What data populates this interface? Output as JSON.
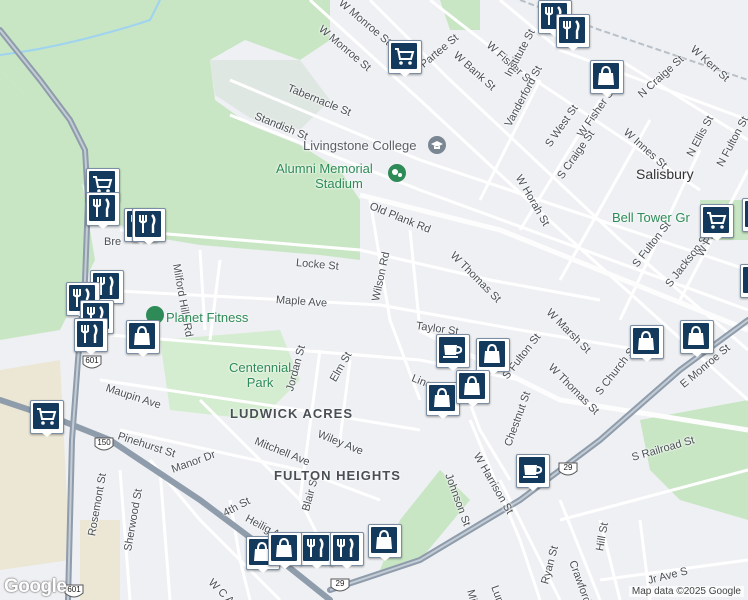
{
  "streets": {
    "w_monroe_st_top": "W Monroe St",
    "w_monroe_st_upper": "W Monroe St",
    "tabernacle_st": "Tabernacle St",
    "standish_st": "Standish St",
    "partee_st": "Partee St",
    "w_bank_st": "W Bank St",
    "w_fisher_st": "W Fisher St",
    "institute_st": "Institute St",
    "vanderford_st": "Vanderford St",
    "n_craige_st": "N Craige St",
    "w_innes_st": "W Innes St",
    "w_kerr_st": "W Kerr St",
    "s_west_st": "S West St",
    "w_fisher_st_2": "W Fisher St",
    "s_craige_st": "S Craige St",
    "w_horah_st": "W Horah St",
    "n_ellis_st": "N Ellis St",
    "n_fulton_st": "N Fulton St",
    "old_plank_rd": "Old Plank Rd",
    "w_thomas_st": "W Thomas St",
    "locke_st": "Locke St",
    "wilson_rd": "Wilson Rd",
    "maple_ave": "Maple Ave",
    "milford_hills_rd": "Milford Hills Rd",
    "taylor_st": "Taylor St",
    "w_marsh_st": "W Marsh St",
    "s_fulton_st_a": "S Fulton St",
    "s_fulton_st_b": "S Fulton St",
    "w_thomas_st_2": "W Thomas St",
    "s_church_st": "S Church St",
    "s_jackson_st": "S Jackson St",
    "w_fisher_st_3": "W Fisher St",
    "e_monroe_st": "E Monroe St",
    "jordan_st": "Jordan St",
    "elm_st": "Elm St",
    "lincoln_rd": "Lincoln Rd",
    "maupin_ave": "Maupin Ave",
    "pinehurst_st": "Pinehurst St",
    "mitchell_ave": "Mitchell Ave",
    "wiley_ave": "Wiley Ave",
    "w_harrison_st": "W Harrison St",
    "chestnut_st": "Chestnut St",
    "johnson_st": "Johnson St",
    "s_railroad_st": "S Railroad St",
    "manor_dr": "Manor Dr",
    "rosemont_st": "Rosemont St",
    "sherwood_st": "Sherwood St",
    "heilig_ave": "Heilig Ave",
    "fourth_st": "4th St",
    "blair_st": "Blair St",
    "wc_ave": "W C Ave",
    "ryan_st": "Ryan St",
    "crawford_st": "Crawford St",
    "hill_st": "Hill St",
    "jr_ave": "Jr Ave S",
    "lumber_st": "Lumb",
    "mid_st": "Mid",
    "bre_st": "Bre"
  },
  "places": {
    "livingstone_college": "Livingstone College",
    "alumni_stadium_l1": "Alumni Memorial",
    "alumni_stadium_l2": "Stadium",
    "salisbury": "Salisbury",
    "bell_tower": "Bell Tower Gr",
    "planet_fitness": "Planet Fitness",
    "centennial_park_l1": "Centennial",
    "centennial_park_l2": "Park",
    "ludwick_acres": "LUDWICK ACRES",
    "fulton_heights": "FULTON HEIGHTS"
  },
  "routes": {
    "us_601_a": "601",
    "us_150": "150",
    "us_29_a": "29",
    "us_601_b": "601",
    "us_29_b": "29"
  },
  "attribution": "Map data ©2025 Google",
  "logo": "Google",
  "markers": [
    {
      "icon": "grocery"
    },
    {
      "icon": "grocery"
    },
    {
      "icon": "grocery"
    },
    {
      "icon": "grocery"
    },
    {
      "icon": "restaurant"
    },
    {
      "icon": "restaurant"
    },
    {
      "icon": "restaurant"
    },
    {
      "icon": "restaurant"
    },
    {
      "icon": "restaurant"
    },
    {
      "icon": "restaurant"
    },
    {
      "icon": "restaurant"
    },
    {
      "icon": "restaurant"
    },
    {
      "icon": "restaurant"
    },
    {
      "icon": "restaurant"
    },
    {
      "icon": "restaurant"
    },
    {
      "icon": "shopping"
    },
    {
      "icon": "shopping"
    },
    {
      "icon": "shopping"
    },
    {
      "icon": "shopping"
    },
    {
      "icon": "shopping"
    },
    {
      "icon": "shopping"
    },
    {
      "icon": "shopping"
    },
    {
      "icon": "shopping"
    },
    {
      "icon": "shopping"
    },
    {
      "icon": "shopping"
    },
    {
      "icon": "shopping"
    },
    {
      "icon": "school"
    },
    {
      "icon": "cafe"
    }
  ],
  "colors": {
    "park": "#c8e6c4",
    "water": "#9fd3f0",
    "highway": "#8e9cab",
    "marker": "#133a5c",
    "poi_green": "#2e8b57"
  }
}
